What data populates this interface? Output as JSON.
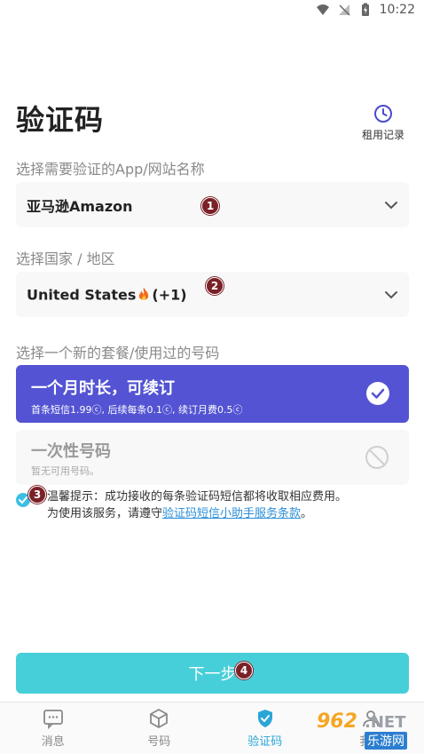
{
  "status_bar": {
    "time": "10:22"
  },
  "header": {
    "title": "验证码",
    "history_label": "租用记录"
  },
  "app_section": {
    "label": "选择需要验证的App/网站名称",
    "value": "亚马逊Amazon",
    "marker": "1"
  },
  "country_section": {
    "label": "选择国家 / 地区",
    "value_text": "United States",
    "value_code": "(+1)",
    "marker": "2"
  },
  "plan_section": {
    "label": "选择一个新的套餐/使用过的号码",
    "plans": [
      {
        "title": "一个月时长，可续订",
        "subtitle": "首条短信1.99ⓒ, 后续每条0.1ⓒ, 续订月费0.5ⓒ",
        "selected": true
      },
      {
        "title": "一次性号码",
        "subtitle": "暂无可用号码。",
        "disabled": true
      }
    ]
  },
  "tip": {
    "marker": "3",
    "line1": "温馨提示：成功接收的每条验证码短信都将收取相应费用。",
    "line2_prefix": "为使用该服务，请遵守",
    "link": "验证码短信小助手服务条款",
    "line2_suffix": "。"
  },
  "next_button": {
    "label": "下一步",
    "marker": "4"
  },
  "tabs": [
    {
      "label": "消息",
      "icon": "message-icon",
      "active": false
    },
    {
      "label": "号码",
      "icon": "box-icon",
      "active": false
    },
    {
      "label": "验证码",
      "icon": "shield-check-icon",
      "active": true
    },
    {
      "label": "我的",
      "icon": "user-icon",
      "active": false
    }
  ],
  "watermark": {
    "num": "962",
    "net": ".NET",
    "cn": "乐游网"
  },
  "colors": {
    "primary": "#5353d3",
    "accent": "#47cfd9",
    "link": "#2c8fd8",
    "tab_active": "#2aa6d6"
  }
}
